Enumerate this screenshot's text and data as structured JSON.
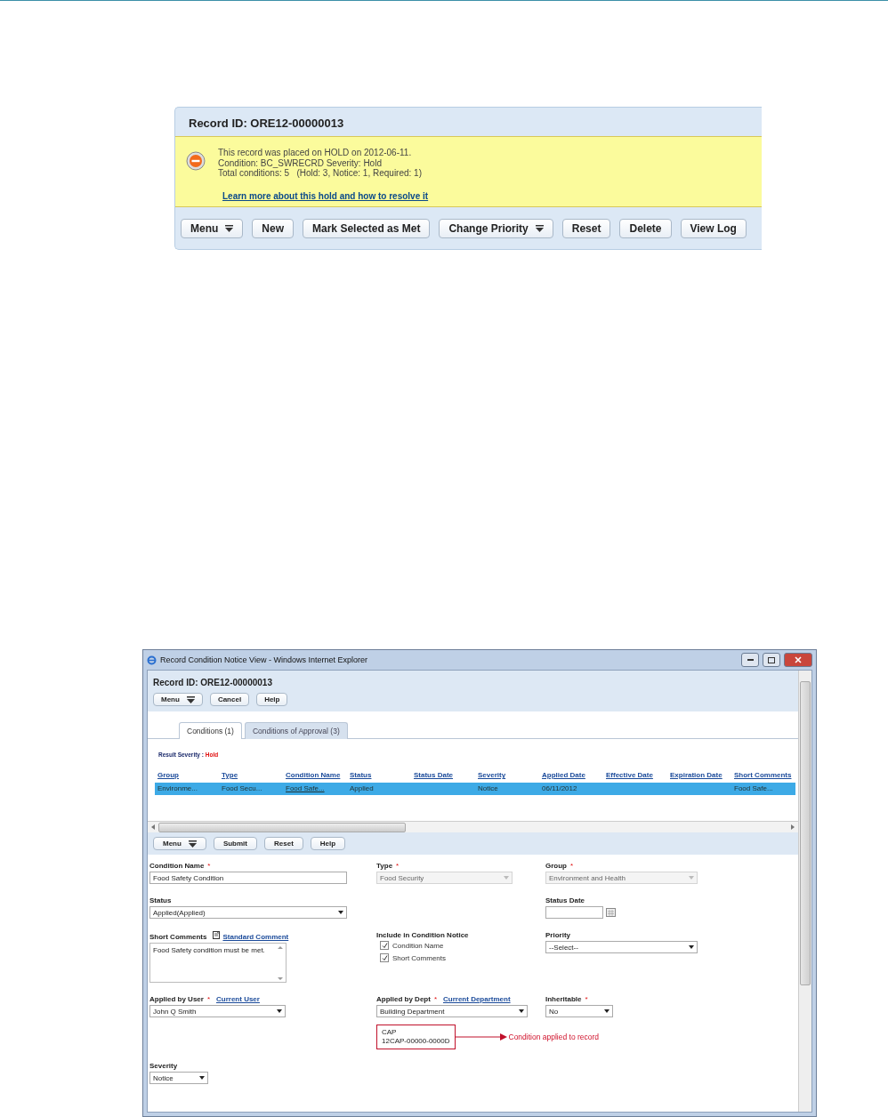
{
  "hold_panel": {
    "record_id": "Record ID: ORE12-00000013",
    "message_lines": [
      "This record was placed on HOLD on 2012-06-11.",
      "Condition: BC_SWRECRD Severity: Hold",
      "Total conditions: 5   (Hold: 3, Notice: 1, Required: 1)"
    ],
    "link": "Learn more about this hold and how to resolve it",
    "buttons": [
      {
        "label": "Menu",
        "kind": "menu"
      },
      {
        "label": "New",
        "kind": "plain"
      },
      {
        "label": "Mark Selected as Met",
        "kind": "plain"
      },
      {
        "label": "Change Priority",
        "kind": "menu"
      },
      {
        "label": "Reset",
        "kind": "plain"
      },
      {
        "label": "Delete",
        "kind": "plain"
      },
      {
        "label": "View Log",
        "kind": "plain"
      }
    ]
  },
  "window": {
    "title": "Record Condition Notice View - Windows Internet Explorer",
    "record_id": "Record ID: ORE12-00000013",
    "header_buttons": [
      {
        "label": "Menu",
        "kind": "menu"
      },
      {
        "label": "Cancel",
        "kind": "plain"
      },
      {
        "label": "Help",
        "kind": "plain"
      }
    ],
    "tabs": [
      {
        "label": "Conditions (1)",
        "selected": true
      },
      {
        "label": "Conditions of Approval (3)",
        "selected": false
      }
    ],
    "result_severity": {
      "label": "Result Severity :",
      "value": "Hold"
    },
    "table": {
      "columns": [
        "Group",
        "Type",
        "Condition Name",
        "Status",
        "Status Date",
        "Severity",
        "Applied Date",
        "Effective Date",
        "Expiration Date",
        "Short Comments"
      ],
      "rows": [
        {
          "selected": true,
          "cells": [
            {
              "kind": "text",
              "text": "Environme..."
            },
            {
              "kind": "text",
              "text": "Food Secu..."
            },
            {
              "kind": "link",
              "text": "Food Safe..."
            },
            {
              "kind": "text",
              "text": "Applied"
            },
            {
              "kind": "empty"
            },
            {
              "kind": "text",
              "text": "Notice"
            },
            {
              "kind": "text",
              "text": "06/11/2012"
            },
            {
              "kind": "empty"
            },
            {
              "kind": "empty"
            },
            {
              "kind": "text",
              "text": "Food Safe..."
            }
          ]
        }
      ]
    },
    "toolbar": [
      {
        "label": "Menu",
        "kind": "menu"
      },
      {
        "label": "Submit",
        "kind": "plain"
      },
      {
        "label": "Reset",
        "kind": "plain"
      },
      {
        "label": "Help",
        "kind": "plain"
      }
    ],
    "form": {
      "rows": [
        [
          {
            "label": "Condition Name",
            "required_mark": "*",
            "kind": "text",
            "disabled": false,
            "value": "Food Safety Condition"
          },
          {
            "label": "Type",
            "required_mark": "*",
            "kind": "select",
            "disabled": true,
            "value": "Food Security"
          },
          {
            "label": "Group",
            "required_mark": "*",
            "kind": "select",
            "disabled": true,
            "value": "Environment and Health"
          }
        ],
        [
          {
            "label": "Status",
            "kind": "select",
            "disabled": false,
            "value": "Applied(Applied)"
          },
          null,
          {
            "label": "Status Date",
            "kind": "date"
          }
        ],
        [
          {
            "label": "Short Comments",
            "kind": "textarea",
            "link": "Standard Comment",
            "value": "Food Safety condition must be met."
          },
          {
            "label": "Include in Condition Notice",
            "kind": "checkboxes",
            "options": [
              {
                "label": "Condition Name",
                "checked": true
              },
              {
                "label": "Short Comments",
                "checked": true
              }
            ]
          },
          {
            "label": "Priority",
            "kind": "select",
            "disabled": false,
            "value": "--Select--"
          }
        ],
        [
          {
            "label": "Applied by User",
            "required_mark": "*",
            "kind": "select",
            "disabled": false,
            "link": "Current User",
            "value": "John Q Smith"
          },
          {
            "label": "Applied by Dept",
            "required_mark": "*",
            "kind": "select",
            "disabled": false,
            "link": "Current Department",
            "value": "Building Department"
          },
          {
            "label": "Inheritable",
            "required_mark": "*",
            "kind": "select",
            "disabled": false,
            "value": "No"
          }
        ]
      ],
      "annotation": {
        "box_lines": [
          "CAP",
          "12CAP-00000-0000D"
        ],
        "note": "Condition applied to record"
      },
      "last_rows": [
        [
          {
            "label": "Severity",
            "kind": "select",
            "disabled": false,
            "value": "Notice"
          },
          null,
          null
        ]
      ]
    }
  }
}
